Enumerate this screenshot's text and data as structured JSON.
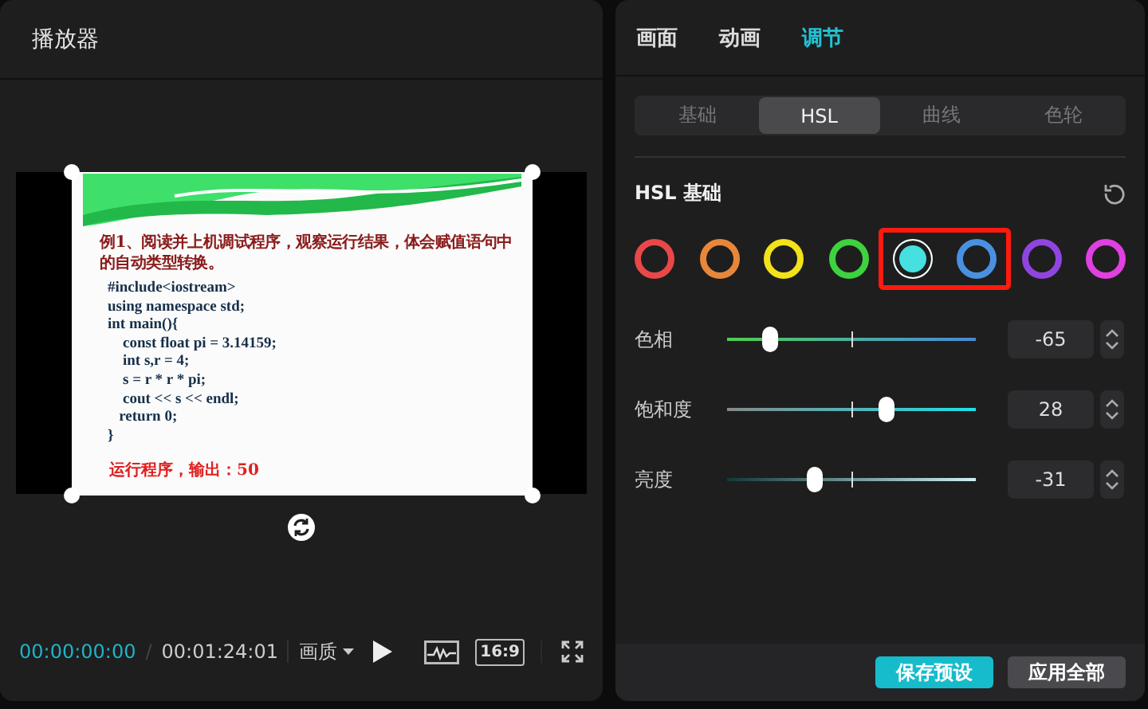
{
  "player": {
    "title": "播放器",
    "slide": {
      "title": "例1、阅读并上机调试程序，观察运行结果，体会赋值语句中的自动类型转换。",
      "code": [
        "#include<iostream>",
        "using namespace std;",
        "int main(){",
        "    const float pi = 3.14159;",
        "    int s,r = 4;",
        "    s = r * r * pi;",
        "    cout << s << endl;",
        "   return 0;",
        "}"
      ],
      "output": "运行程序，输出：50"
    },
    "current_time": "00:00:00:00",
    "separator": "/",
    "total_time": "00:01:24:01",
    "quality": "画质",
    "aspect": "16:9"
  },
  "inspector": {
    "tabs": [
      {
        "label": "画面",
        "selected": false
      },
      {
        "label": "动画",
        "selected": false
      },
      {
        "label": "调节",
        "selected": true
      }
    ],
    "subtabs": [
      {
        "label": "基础",
        "selected": false
      },
      {
        "label": "HSL",
        "selected": true
      },
      {
        "label": "曲线",
        "selected": false
      },
      {
        "label": "色轮",
        "selected": false
      }
    ],
    "section_title": "HSL 基础",
    "swatches": [
      {
        "color": "#e84848",
        "selected": false,
        "highlighted": false
      },
      {
        "color": "#e8873a",
        "selected": false,
        "highlighted": false
      },
      {
        "color": "#f2e21a",
        "selected": false,
        "highlighted": false
      },
      {
        "color": "#3ed23e",
        "selected": false,
        "highlighted": false
      },
      {
        "color": "#46e0e0",
        "selected": true,
        "highlighted": true
      },
      {
        "color": "#4a90e0",
        "selected": false,
        "highlighted": true
      },
      {
        "color": "#9045e0",
        "selected": false,
        "highlighted": false
      },
      {
        "color": "#e040e0",
        "selected": false,
        "highlighted": false
      }
    ],
    "sliders": [
      {
        "label": "色相",
        "kind": "hue",
        "level": 0.17,
        "reading": "-65"
      },
      {
        "label": "饱和度",
        "kind": "saturation",
        "level": 0.64,
        "reading": "28"
      },
      {
        "label": "亮度",
        "kind": "lightness",
        "level": 0.35,
        "reading": "-31"
      }
    ],
    "buttons": [
      {
        "label": "保存预设",
        "kind": "primary"
      },
      {
        "label": "应用全部",
        "kind": "secondary"
      }
    ]
  }
}
